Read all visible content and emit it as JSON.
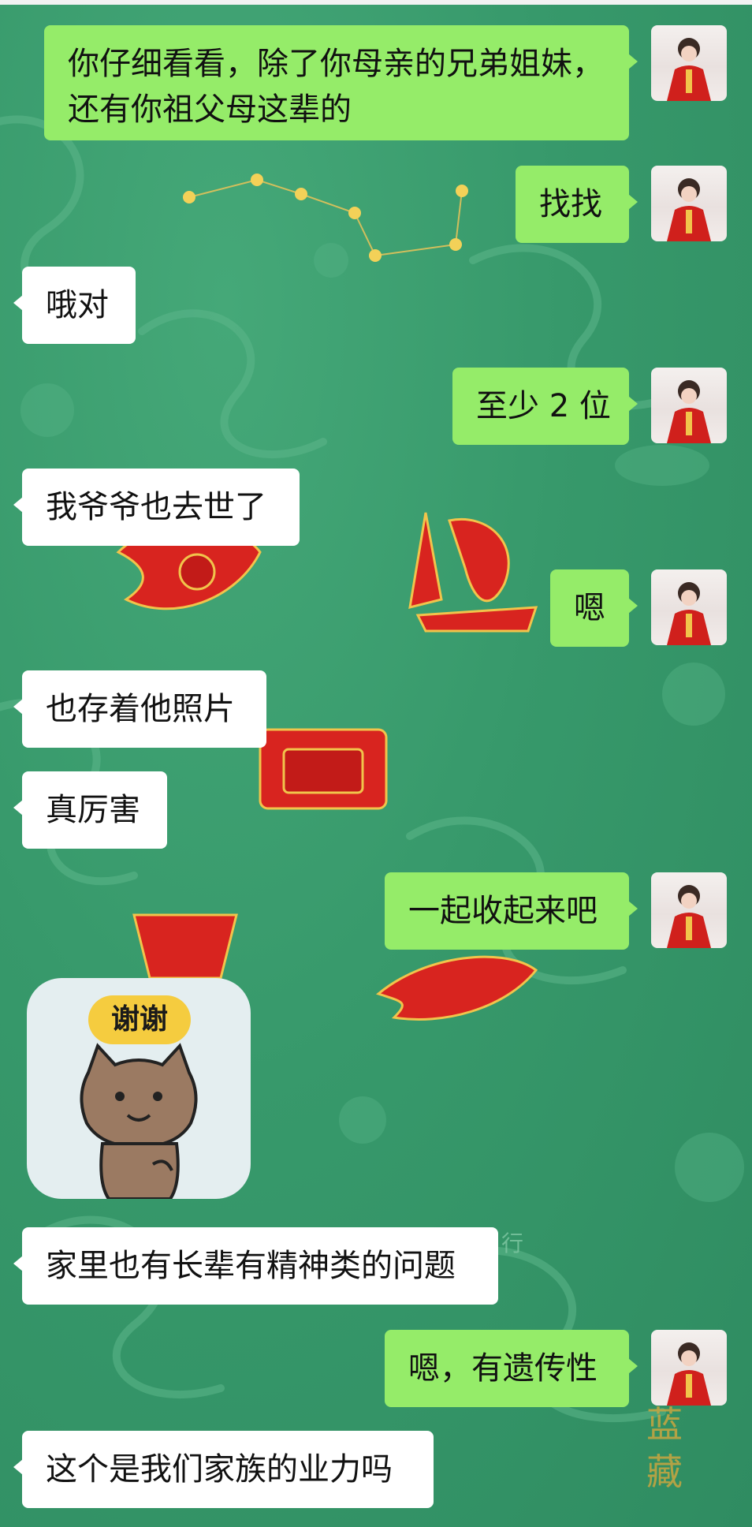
{
  "conversation": {
    "messages": [
      {
        "side": "out",
        "lines": [
          "你仔细看看，除了你母亲的兄弟姐妹，",
          "还有你祖父母这辈的"
        ]
      },
      {
        "side": "out",
        "text": "找找"
      },
      {
        "side": "in",
        "text": "哦对"
      },
      {
        "side": "out",
        "text": "至少 2 位"
      },
      {
        "side": "in",
        "text": "我爷爷也去世了"
      },
      {
        "side": "out",
        "text": "嗯"
      },
      {
        "side": "in",
        "text": "也存着他照片"
      },
      {
        "side": "in",
        "text": "真厉害"
      },
      {
        "side": "out",
        "text": "一起收起来吧"
      },
      {
        "side": "in",
        "sticker": "thank-you-cat-sticker",
        "sticker_text": "谢谢"
      },
      {
        "side": "in",
        "text": "家里也有长辈有精神类的问题"
      },
      {
        "side": "out",
        "text": "嗯，有遗传性"
      },
      {
        "side": "in",
        "text": "这个是我们家族的业力吗"
      }
    ]
  },
  "background": {
    "watermark_chars": [
      "行",
      "蓝",
      "藏"
    ]
  },
  "colors": {
    "outgoing_bubble": "#95ec69",
    "incoming_bubble": "#ffffff",
    "background": "#37996b"
  }
}
